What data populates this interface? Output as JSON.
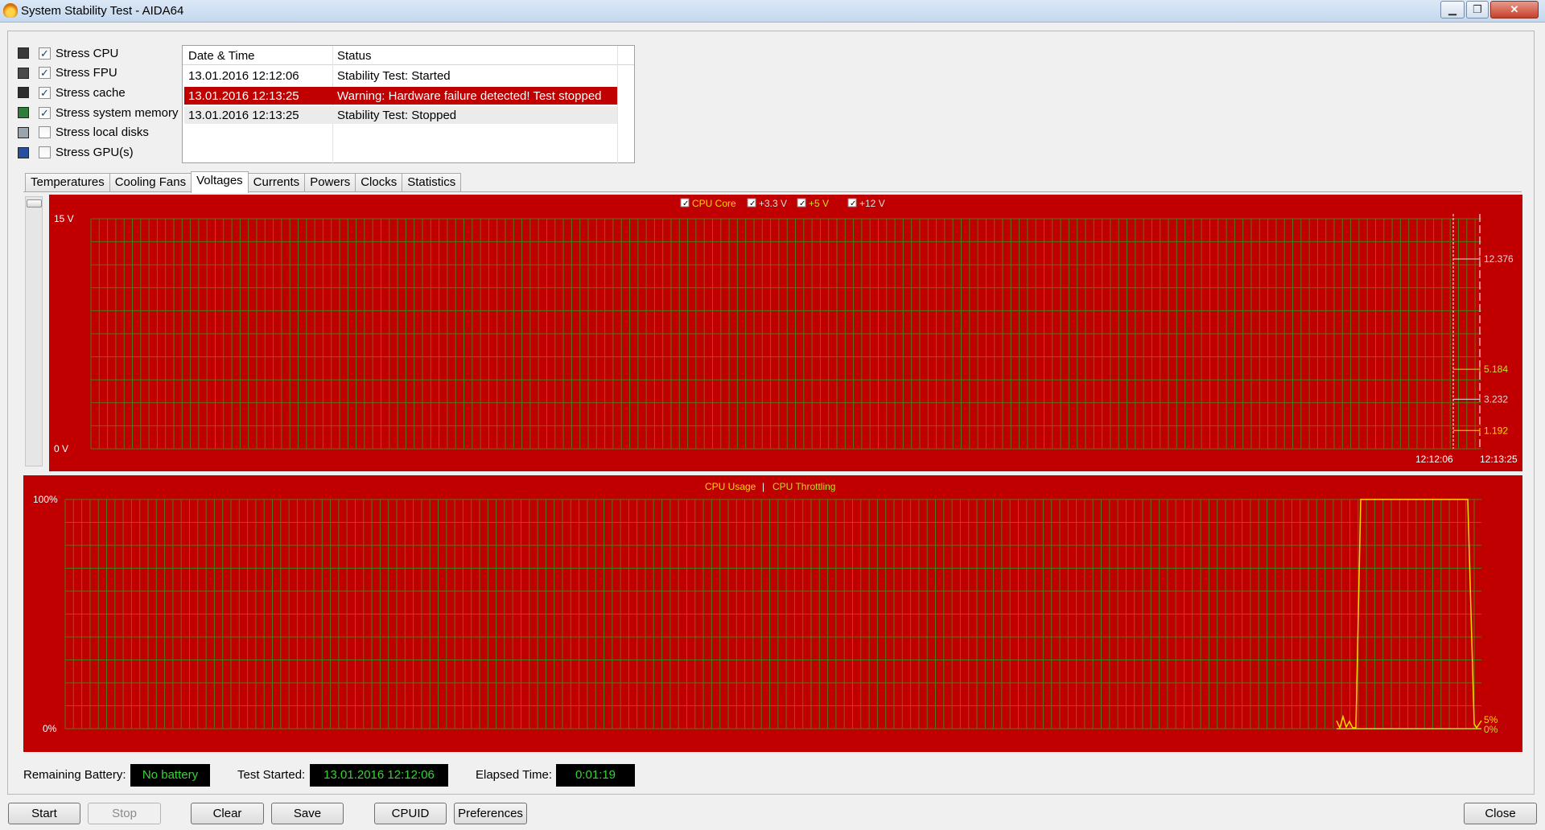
{
  "window": {
    "title": "System Stability Test - AIDA64",
    "min": "▁",
    "max": "❐",
    "close": "✕"
  },
  "options": [
    {
      "label": "Stress CPU",
      "checked": true,
      "icon": "cpu-icon"
    },
    {
      "label": "Stress FPU",
      "checked": true,
      "icon": "fpu-icon"
    },
    {
      "label": "Stress cache",
      "checked": true,
      "icon": "cache-icon"
    },
    {
      "label": "Stress system memory",
      "checked": true,
      "icon": "memory-icon"
    },
    {
      "label": "Stress local disks",
      "checked": false,
      "icon": "disk-icon"
    },
    {
      "label": "Stress GPU(s)",
      "checked": false,
      "icon": "gpu-icon"
    }
  ],
  "log": {
    "headers": [
      "Date & Time",
      "Status"
    ],
    "rows": [
      {
        "time": "13.01.2016 12:12:06",
        "status": "Stability Test: Started",
        "state": "normal"
      },
      {
        "time": "13.01.2016 12:13:25",
        "status": "Warning: Hardware failure detected! Test stopped",
        "state": "error"
      },
      {
        "time": "13.01.2016 12:13:25",
        "status": "Stability Test: Stopped",
        "state": "selected"
      }
    ]
  },
  "tabs": [
    "Temperatures",
    "Cooling Fans",
    "Voltages",
    "Currents",
    "Powers",
    "Clocks",
    "Statistics"
  ],
  "active_tab": "Voltages",
  "voltage_chart": {
    "legend": [
      {
        "name": "CPU Core",
        "color": "#ffd700"
      },
      {
        "name": "+3.3 V",
        "color": "#e0e0e0"
      },
      {
        "name": "+5 V",
        "color": "#c8e02a"
      },
      {
        "name": "+12 V",
        "color": "#e0e0e0"
      }
    ],
    "y_top": "15 V",
    "y_bottom": "0 V",
    "values": [
      {
        "label": "12.376",
        "color": "#dddddd",
        "v": 12.376
      },
      {
        "label": "5.184",
        "color": "#c8e02a",
        "v": 5.184
      },
      {
        "label": "3.232",
        "color": "#dddddd",
        "v": 3.232
      },
      {
        "label": "1.192",
        "color": "#ffd700",
        "v": 1.192
      }
    ],
    "x_start": "12:12:06",
    "x_end": "12:13:25"
  },
  "usage_chart": {
    "legend_usage": "CPU Usage",
    "legend_sep": "|",
    "legend_throttling": "CPU Throttling",
    "usage_color": "#ffd700",
    "throttle_color": "#b8e02a",
    "y_top": "100%",
    "y_bottom": "0%",
    "usage_value": "5%",
    "throttle_value": "0%"
  },
  "chart_data": [
    {
      "type": "line",
      "title": "",
      "ylim": [
        0,
        15
      ],
      "y_ticks": [
        "0 V",
        "15 V"
      ],
      "x_ticks": [
        "12:12:06",
        "12:13:25"
      ],
      "series": [
        {
          "name": "CPU Core",
          "values": [
            1.192
          ]
        },
        {
          "name": "+3.3 V",
          "values": [
            3.232
          ]
        },
        {
          "name": "+5 V",
          "values": [
            5.184
          ]
        },
        {
          "name": "+12 V",
          "values": [
            12.376
          ]
        }
      ]
    },
    {
      "type": "line",
      "title": "",
      "ylim": [
        0,
        100
      ],
      "y_ticks": [
        "0%",
        "100%"
      ],
      "series": [
        {
          "name": "CPU Usage",
          "values": [
            5,
            5,
            100,
            100,
            100,
            5
          ]
        },
        {
          "name": "CPU Throttling",
          "values": [
            0,
            0,
            0,
            0,
            0,
            0
          ]
        }
      ]
    }
  ],
  "status": {
    "battery_label": "Remaining Battery:",
    "battery_value": "No battery",
    "started_label": "Test Started:",
    "started_value": "13.01.2016 12:12:06",
    "elapsed_label": "Elapsed Time:",
    "elapsed_value": "0:01:19"
  },
  "buttons": {
    "start": "Start",
    "stop": "Stop",
    "clear": "Clear",
    "save": "Save",
    "cpuid": "CPUID",
    "preferences": "Preferences",
    "close": "Close"
  }
}
